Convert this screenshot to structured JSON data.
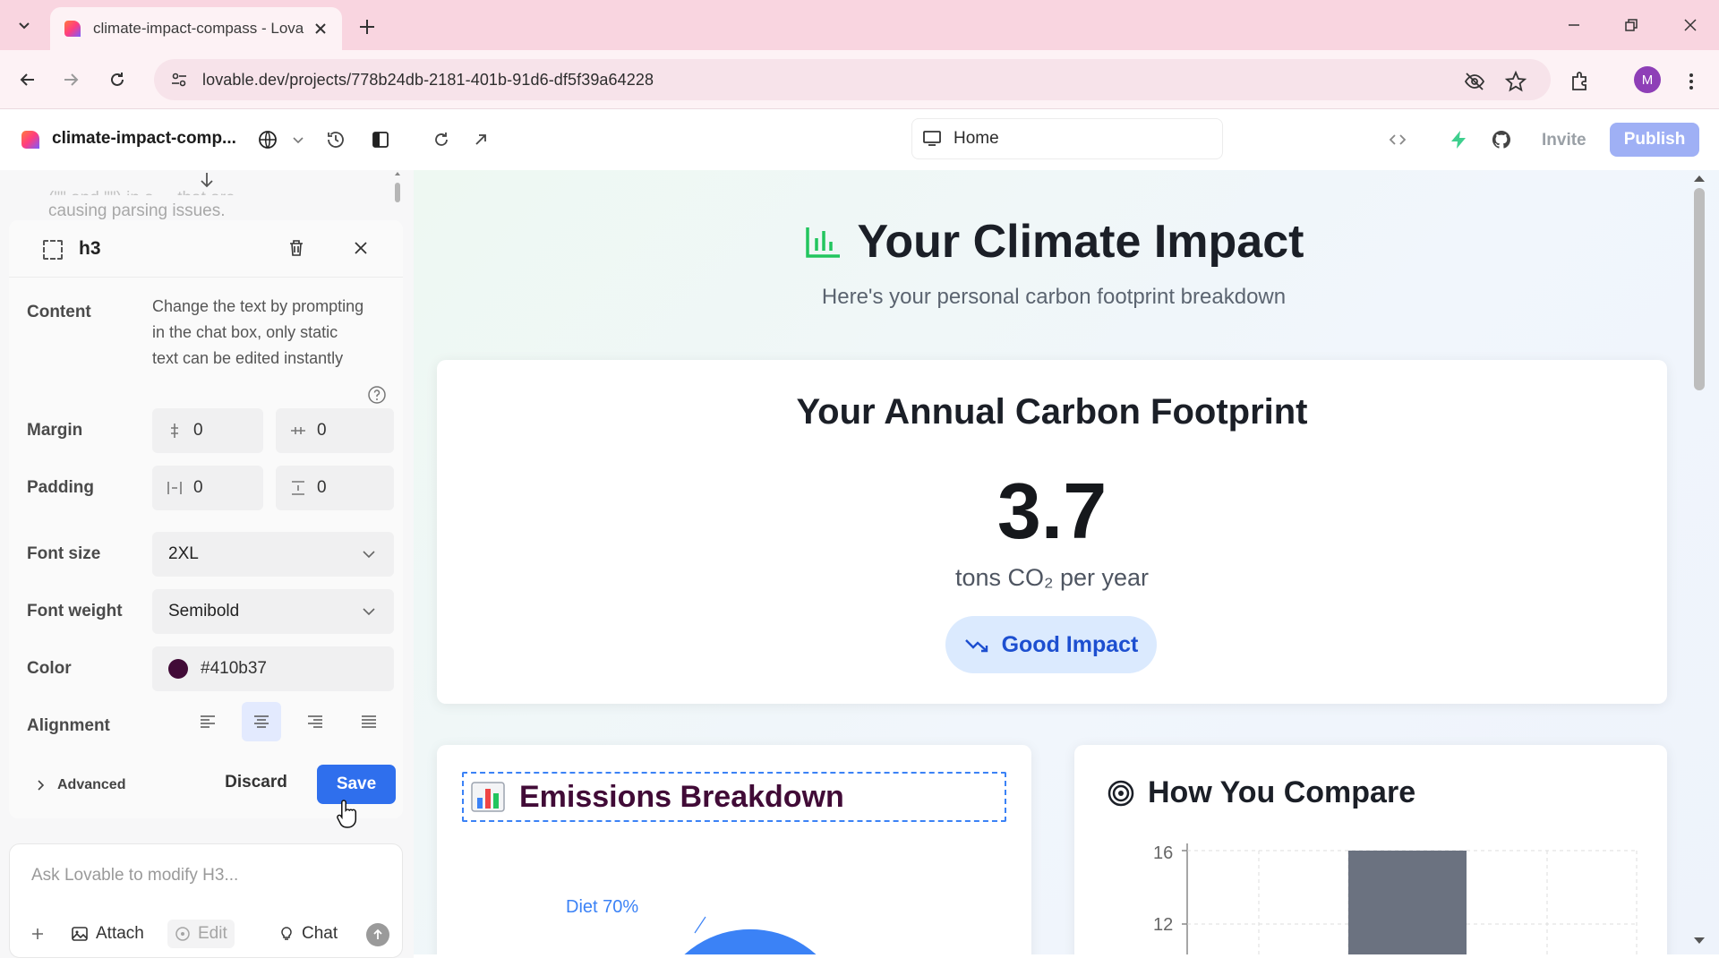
{
  "browser": {
    "tab_title": "climate-impact-compass - Lova",
    "url": "lovable.dev/projects/778b24db-2181-401b-91d6-df5f39a64228",
    "profile_initial": "M"
  },
  "app": {
    "project_name": "climate-impact-comp...",
    "route": "Home",
    "invite_label": "Invite",
    "publish_label": "Publish"
  },
  "chat": {
    "faded_line_1": "(\"\" and \"\") in a ... that are",
    "faded_line_2": "causing parsing issues."
  },
  "editor": {
    "element_tag": "h3",
    "content_label": "Content",
    "content_desc": "Change the text by prompting in the chat box, only static text can be edited instantly",
    "margin_label": "Margin",
    "margin_y": "0",
    "margin_x": "0",
    "padding_label": "Padding",
    "padding_x": "0",
    "padding_y": "0",
    "font_size_label": "Font size",
    "font_size_value": "2XL",
    "font_weight_label": "Font weight",
    "font_weight_value": "Semibold",
    "color_label": "Color",
    "color_value": "#410b37",
    "alignment_label": "Alignment",
    "alignment_selected": "center",
    "advanced_label": "Advanced",
    "discard_label": "Discard",
    "save_label": "Save"
  },
  "composer": {
    "placeholder": "Ask Lovable to modify H3...",
    "attach_label": "Attach",
    "edit_label": "Edit",
    "chat_label": "Chat"
  },
  "preview": {
    "hero_title": "Your Climate Impact",
    "hero_subtitle": "Here's your personal carbon footprint breakdown",
    "footprint_title": "Your Annual Carbon Footprint",
    "footprint_value": "3.7",
    "footprint_unit": "tons CO₂ per year",
    "impact_badge": "Good Impact",
    "breakdown_title": "Emissions Breakdown",
    "breakdown_pie_label": "Diet 70%",
    "compare_title": "How You Compare",
    "compare_ticks": [
      "16",
      "12"
    ]
  },
  "colors": {
    "accent_blue": "#2f6fed",
    "publish_bg": "#9fb0f5",
    "badge_bg": "#dbeafe",
    "badge_text": "#1d4fd0",
    "selected_text_color": "#410b37",
    "pie_blue": "#3b82f6",
    "bar_gray": "#6b7280",
    "chart_green": "#22c55e"
  }
}
